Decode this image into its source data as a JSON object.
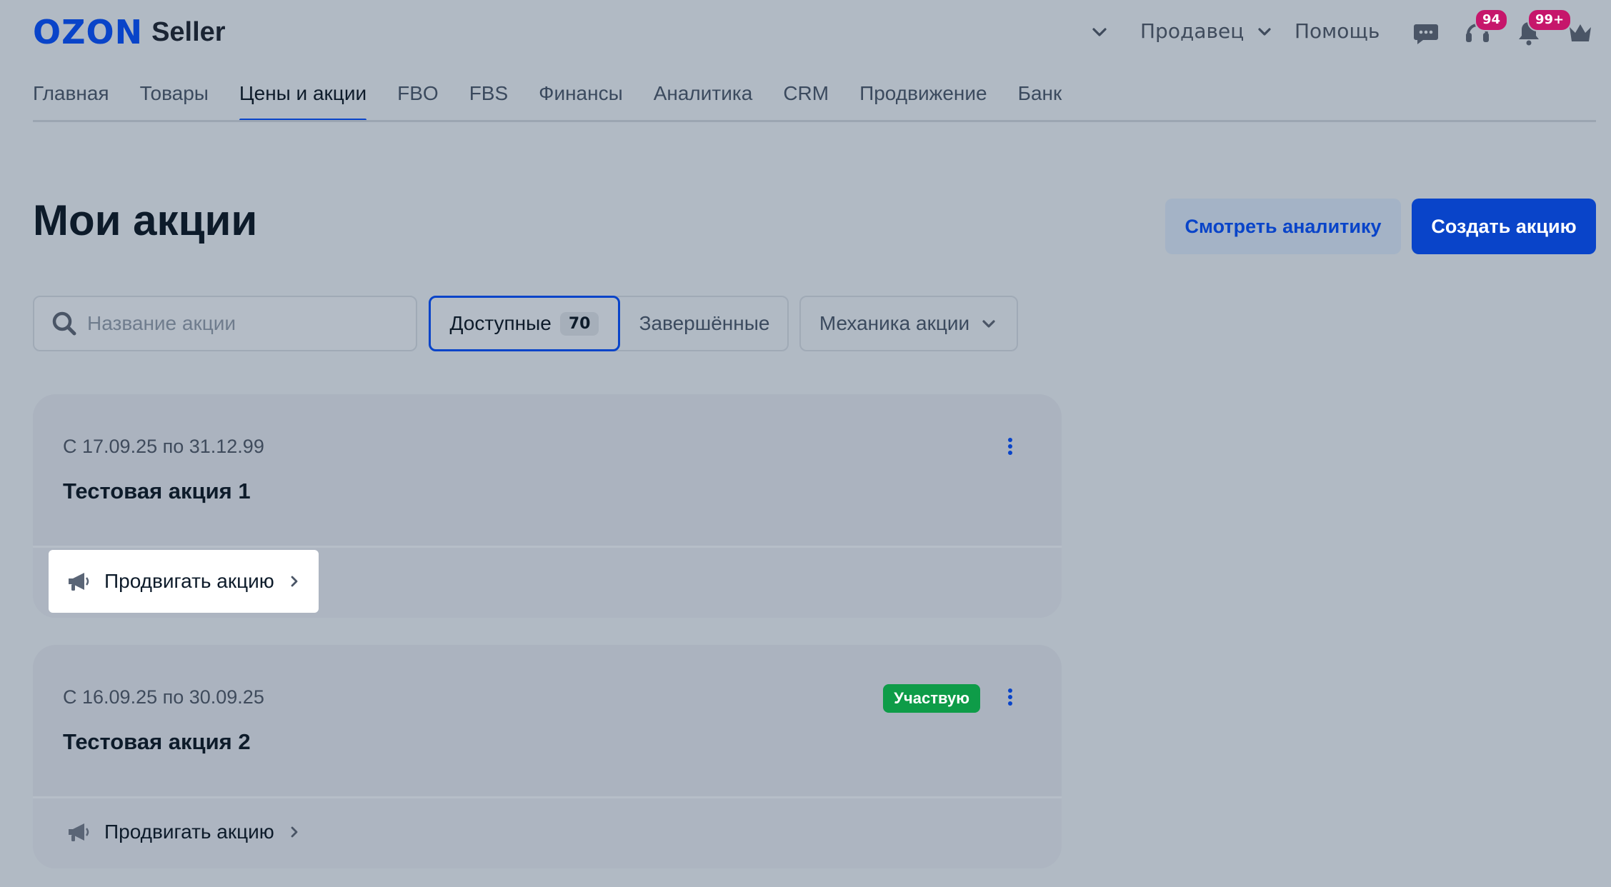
{
  "header": {
    "logo_ozon": "OZON",
    "logo_seller": "Seller",
    "seller_menu": "Продавец",
    "help": "Помощь",
    "support_badge": "94",
    "notifications_badge": "99+"
  },
  "nav": {
    "tabs": [
      {
        "label": "Главная",
        "active": false
      },
      {
        "label": "Товары",
        "active": false
      },
      {
        "label": "Цены и акции",
        "active": true
      },
      {
        "label": "FBO",
        "active": false
      },
      {
        "label": "FBS",
        "active": false
      },
      {
        "label": "Финансы",
        "active": false
      },
      {
        "label": "Аналитика",
        "active": false
      },
      {
        "label": "CRM",
        "active": false
      },
      {
        "label": "Продвижение",
        "active": false
      },
      {
        "label": "Банк",
        "active": false
      }
    ]
  },
  "page": {
    "title": "Мои акции",
    "analytics_button": "Смотреть аналитику",
    "create_button": "Создать акцию"
  },
  "filters": {
    "search_placeholder": "Название акции",
    "search_value": "",
    "tab_available": "Доступные",
    "tab_available_count": "70",
    "tab_finished": "Завершённые",
    "mechanics_dropdown": "Механика акции"
  },
  "promotions": [
    {
      "date_range": "С 17.09.25 по 31.12.99",
      "name": "Тестовая акция 1",
      "status": "",
      "promote_label": "Продвигать акцию"
    },
    {
      "date_range": "С 16.09.25 по 30.09.25",
      "name": "Тестовая акция 2",
      "status": "Участвую",
      "promote_label": "Продвигать акцию"
    }
  ],
  "colors": {
    "accent": "#0944c9",
    "badge": "#c6166b",
    "status_green": "#0e9c48",
    "background": "#b1bac4"
  }
}
